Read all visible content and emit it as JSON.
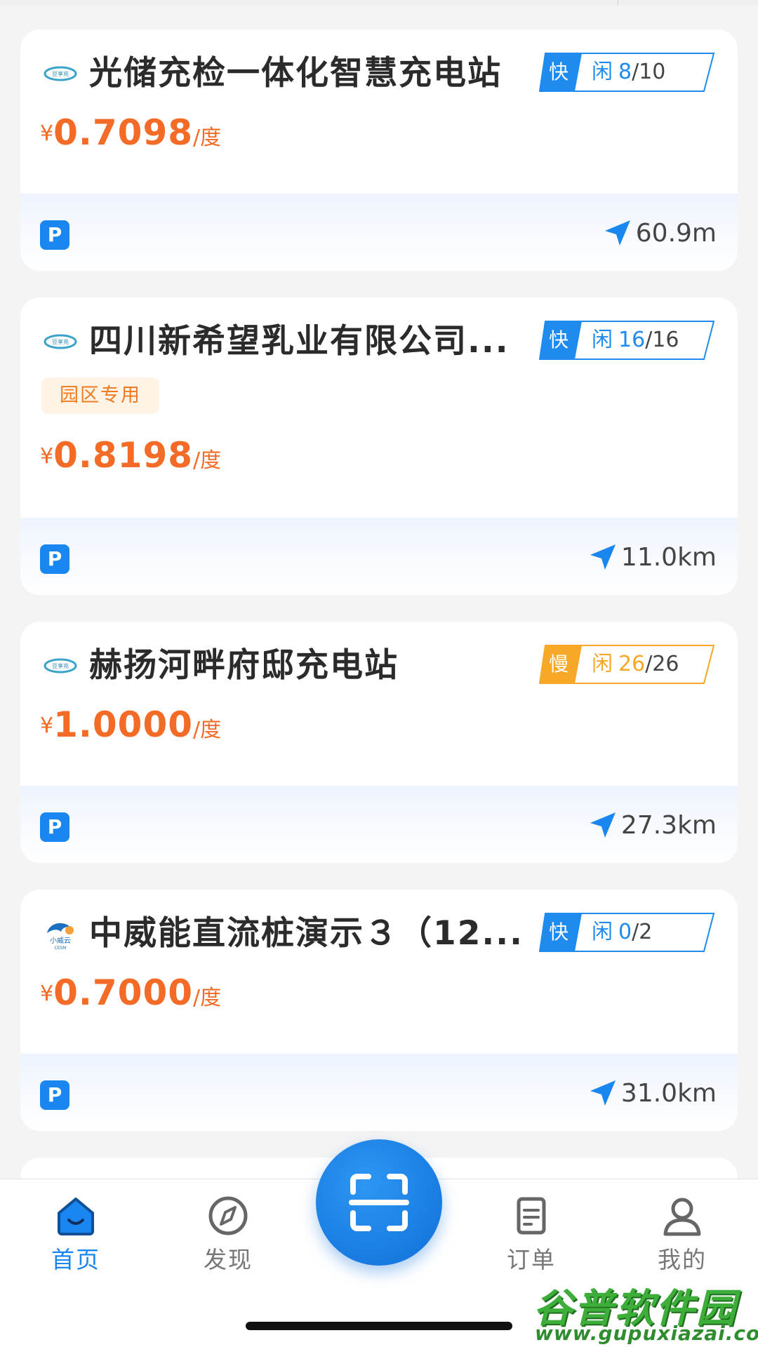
{
  "colors": {
    "accent_blue": "#1a86ef",
    "fast_blue": "#1f8bef",
    "slow_orange": "#f7a826",
    "price_orange": "#f36b26",
    "tag_orange": "#ee7b1f"
  },
  "stations": [
    {
      "name": "光储充检一体化智慧充电站",
      "logo": "station-logo-icon",
      "charge_type": "快",
      "free_label": "闲",
      "free": "8",
      "total": "10",
      "tag": "",
      "currency": "¥",
      "price": "0.7098",
      "unit": "/度",
      "distance": "60.9m"
    },
    {
      "name": "四川新希望乳业有限公司...",
      "logo": "station-logo-icon",
      "charge_type": "快",
      "free_label": "闲",
      "free": "16",
      "total": "16",
      "tag": "园区专用",
      "currency": "¥",
      "price": "0.8198",
      "unit": "/度",
      "distance": "11.0km"
    },
    {
      "name": "赫扬河畔府邸充电站",
      "logo": "station-logo-icon",
      "charge_type": "慢",
      "free_label": "闲",
      "free": "26",
      "total": "26",
      "tag": "",
      "currency": "¥",
      "price": "1.0000",
      "unit": "/度",
      "distance": "27.3km"
    },
    {
      "name": "中威能直流桩演示３（12...",
      "logo": "xiaoweiyun-logo-icon",
      "charge_type": "快",
      "free_label": "闲",
      "free": "0",
      "total": "2",
      "tag": "",
      "currency": "¥",
      "price": "0.7000",
      "unit": "/度",
      "distance": "31.0km"
    }
  ],
  "parking_label": "P",
  "tabs": [
    {
      "label": "首页",
      "icon": "home-icon",
      "active": true
    },
    {
      "label": "发现",
      "icon": "compass-icon",
      "active": false
    },
    {
      "label": "订单",
      "icon": "orders-icon",
      "active": false
    },
    {
      "label": "我的",
      "icon": "profile-icon",
      "active": false
    }
  ],
  "scan_icon": "scan-icon",
  "watermark": {
    "title": "谷普软件园",
    "url": "www.gupuxiazai.com"
  }
}
